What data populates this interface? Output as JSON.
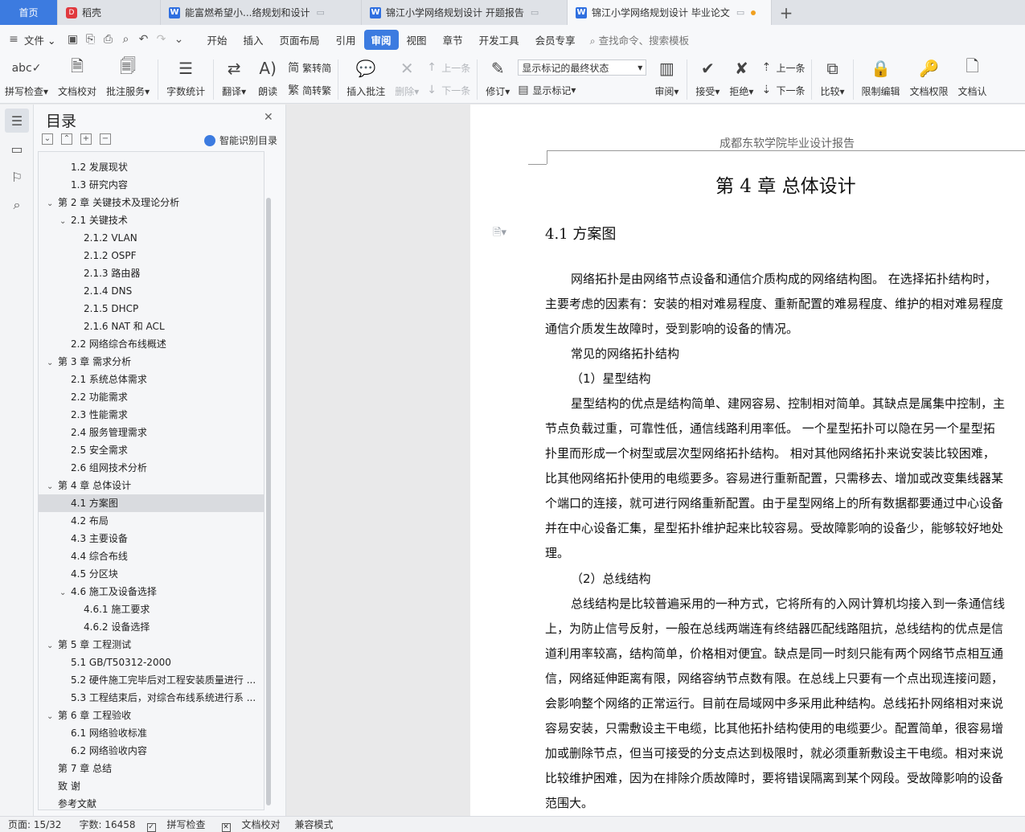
{
  "tabs": {
    "home": "首页",
    "daoke": "稻壳",
    "doc1": "能富燃希望小...络规划和设计",
    "doc2": "锦江小学网络规划设计 开题报告",
    "doc3": "锦江小学网络规划设计 毕业论文",
    "new_tab": "+"
  },
  "menu": {
    "file": "文件",
    "items": [
      "开始",
      "插入",
      "页面布局",
      "引用",
      "审阅",
      "视图",
      "章节",
      "开发工具",
      "会员专享"
    ],
    "search": "查找命令、搜索模板"
  },
  "ribbon": {
    "spell": "拼写检查",
    "proof": "文档校对",
    "annotate": "批注服务",
    "wordcount": "字数统计",
    "translate": "翻译",
    "read": "朗读",
    "trad": "繁转简",
    "simp": "简转繁",
    "insert_comment": "插入批注",
    "delete": "删除",
    "prev": "上一条",
    "next": "下一条",
    "track": "修订",
    "markup_select": "显示标记的最终状态",
    "show_markup": "显示标记",
    "review": "审阅",
    "accept": "接受",
    "reject": "拒绝",
    "prev2": "上一条",
    "next2": "下一条",
    "compare": "比较",
    "restrict": "限制编辑",
    "perm": "文档权限",
    "certify": "文档认"
  },
  "toc": {
    "title": "目录",
    "smart": "智能识别目录",
    "items": [
      {
        "text": "1.2  发展现状",
        "level": 2,
        "caret": ""
      },
      {
        "text": "1.3  研究内容",
        "level": 2,
        "caret": ""
      },
      {
        "text": "第 2 章  关键技术及理论分析",
        "level": 1,
        "caret": "v"
      },
      {
        "text": "2.1  关键技术",
        "level": 2,
        "caret": "v"
      },
      {
        "text": "2.1.2 VLAN",
        "level": 3,
        "caret": ""
      },
      {
        "text": "2.1.2 OSPF",
        "level": 3,
        "caret": ""
      },
      {
        "text": "2.1.3  路由器",
        "level": 3,
        "caret": ""
      },
      {
        "text": "2.1.4 DNS",
        "level": 3,
        "caret": ""
      },
      {
        "text": "2.1.5 DHCP",
        "level": 3,
        "caret": ""
      },
      {
        "text": "2.1.6 NAT 和 ACL",
        "level": 3,
        "caret": ""
      },
      {
        "text": "2.2  网络综合布线概述",
        "level": 2,
        "caret": ""
      },
      {
        "text": "第 3 章  需求分析",
        "level": 1,
        "caret": "v"
      },
      {
        "text": "2.1  系统总体需求",
        "level": 2,
        "caret": ""
      },
      {
        "text": "2.2  功能需求",
        "level": 2,
        "caret": ""
      },
      {
        "text": "2.3  性能需求",
        "level": 2,
        "caret": ""
      },
      {
        "text": "2.4  服务管理需求",
        "level": 2,
        "caret": ""
      },
      {
        "text": "2.5  安全需求",
        "level": 2,
        "caret": ""
      },
      {
        "text": "2.6  组网技术分析",
        "level": 2,
        "caret": ""
      },
      {
        "text": "第 4 章  总体设计",
        "level": 1,
        "caret": "v"
      },
      {
        "text": "4.1  方案图",
        "level": 2,
        "caret": "",
        "selected": true
      },
      {
        "text": "4.2  布局",
        "level": 2,
        "caret": ""
      },
      {
        "text": "4.3  主要设备",
        "level": 2,
        "caret": ""
      },
      {
        "text": "4.4  综合布线",
        "level": 2,
        "caret": ""
      },
      {
        "text": "4.5  分区块",
        "level": 2,
        "caret": ""
      },
      {
        "text": "4.6  施工及设备选择",
        "level": 2,
        "caret": "v"
      },
      {
        "text": "4.6.1  施工要求",
        "level": 3,
        "caret": ""
      },
      {
        "text": "4.6.2  设备选择",
        "level": 3,
        "caret": ""
      },
      {
        "text": "第 5 章  工程测试",
        "level": 1,
        "caret": "v"
      },
      {
        "text": "5.1 GB/T50312-2000",
        "level": 2,
        "caret": ""
      },
      {
        "text": "5.2  硬件施工完毕后对工程安装质量进行 ...",
        "level": 2,
        "caret": ""
      },
      {
        "text": "5.3  工程结束后，对综合布线系统进行系 ...",
        "level": 2,
        "caret": ""
      },
      {
        "text": "第 6 章  工程验收",
        "level": 1,
        "caret": "v"
      },
      {
        "text": "6.1  网络验收标准",
        "level": 2,
        "caret": ""
      },
      {
        "text": "6.2  网络验收内容",
        "level": 2,
        "caret": ""
      },
      {
        "text": "第 7 章  总结",
        "level": 1,
        "caret": ""
      },
      {
        "text": "致    谢",
        "level": 1,
        "caret": ""
      },
      {
        "text": "参考文献",
        "level": 1,
        "caret": ""
      }
    ]
  },
  "page": {
    "header": "成都东软学院毕业设计报告",
    "chapter": "第 4 章  总体设计",
    "section": "4.1  方案图",
    "lines": [
      "网络拓扑是由网络节点设备和通信介质构成的网络结构图。 在选择拓扑结构时，",
      "主要考虑的因素有：安装的相对难易程度、重新配置的难易程度、维护的相对难易程度",
      "通信介质发生故障时，受到影响的设备的情况。",
      "常见的网络拓扑结构",
      "（1）星型结构",
      "星型结构的优点是结构简单、建网容易、控制相对简单。其缺点是属集中控制，主",
      "节点负载过重，可靠性低，通信线路利用率低。 一个星型拓扑可以隐在另一个星型拓",
      "扑里而形成一个树型或层次型网络拓扑结构。 相对其他网络拓扑来说安装比较困难，",
      "比其他网络拓扑使用的电缆要多。容易进行重新配置，只需移去、增加或改变集线器某",
      "个端口的连接，就可进行网络重新配置。由于星型网络上的所有数据都要通过中心设备",
      "并在中心设备汇集，星型拓扑维护起来比较容易。受故障影响的设备少，能够较好地处",
      "理。",
      "（2）总线结构",
      "总线结构是比较普遍采用的一种方式，它将所有的入网计算机均接入到一条通信线",
      "上，为防止信号反射，一般在总线两端连有终结器匹配线路阻抗，总线结构的优点是信",
      "道利用率较高，结构简单，价格相对便宜。缺点是同一时刻只能有两个网络节点相互通",
      "信，网络延伸距离有限，网络容纳节点数有限。在总线上只要有一个点出现连接问题，",
      "会影响整个网络的正常运行。目前在局域网中多采用此种结构。总线拓扑网络相对来说",
      "容易安装，只需敷设主干电缆，比其他拓扑结构使用的电缆要少。配置简单，很容易增",
      "加或删除节点，但当可接受的分支点达到极限时，就必须重新敷设主干电缆。相对来说",
      "比较维护困难，因为在排除介质故障时，要将错误隔离到某个网段。受故障影响的设备",
      "范围大。"
    ],
    "indent": [
      true,
      false,
      false,
      true,
      true,
      true,
      false,
      false,
      false,
      false,
      false,
      false,
      true,
      true,
      false,
      false,
      false,
      false,
      false,
      false,
      false,
      false
    ]
  },
  "status": {
    "page": "页面: 15/32",
    "words": "字数: 16458",
    "spell": "拼写检查",
    "proof": "文档校对",
    "compat": "兼容模式"
  }
}
